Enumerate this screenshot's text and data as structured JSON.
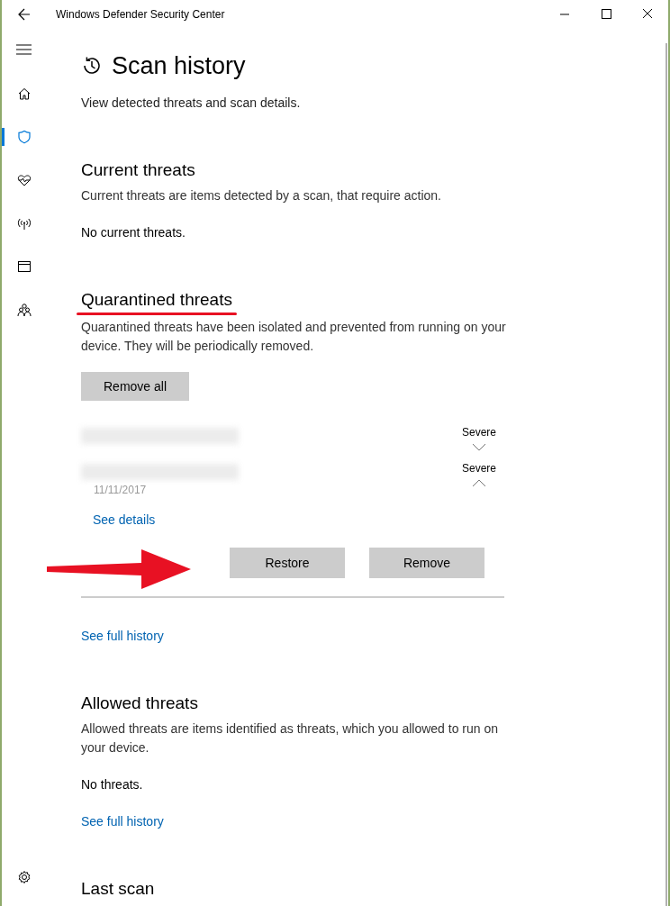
{
  "window": {
    "title": "Windows Defender Security Center"
  },
  "sidebar": {
    "items": [
      {
        "selected": false
      },
      {
        "selected": true
      },
      {
        "selected": false
      },
      {
        "selected": false
      },
      {
        "selected": false
      },
      {
        "selected": false
      }
    ]
  },
  "page": {
    "title": "Scan history",
    "subtitle": "View detected threats and scan details."
  },
  "current_threats": {
    "heading": "Current threats",
    "description": "Current threats are items detected by a scan, that require action.",
    "status": "No current threats."
  },
  "quarantined_threats": {
    "heading": "Quarantined threats",
    "description": "Quarantined threats have been isolated and prevented from running on your device.  They will be periodically removed.",
    "remove_all": "Remove all",
    "items": [
      {
        "severity": "Severe",
        "expanded": false
      },
      {
        "severity": "Severe",
        "expanded": true,
        "date": "11/11/2017",
        "details_link": "See details",
        "buttons": [
          "Restore",
          "Remove"
        ]
      }
    ],
    "history_link": "See full history"
  },
  "allowed_threats": {
    "heading": "Allowed threats",
    "description": "Allowed threats are items identified as threats, which you allowed to run on your device.",
    "status": "No threats.",
    "history_link": "See full history"
  },
  "last_scan": {
    "heading": "Last scan"
  }
}
